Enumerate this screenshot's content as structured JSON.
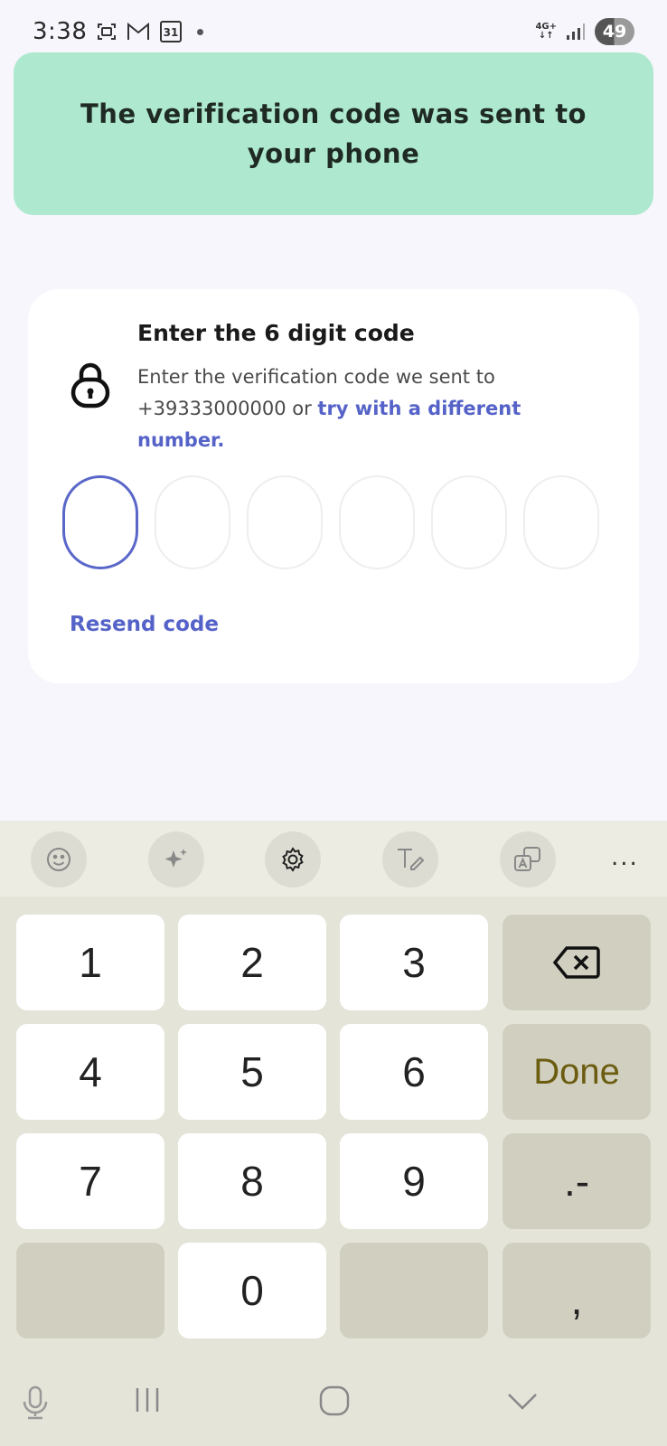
{
  "status_bar": {
    "time": "3:38",
    "network": "4G+",
    "battery": "49",
    "icons": [
      "screenshot-icon",
      "gmail-icon",
      "calendar-icon"
    ],
    "calendar_day": "31"
  },
  "toast": {
    "message": "The verification code was sent to your phone",
    "color": "#aee9cf"
  },
  "verification": {
    "title": "Enter the 6 digit code",
    "description_prefix": "Enter the verification code we sent to +39333000000 or ",
    "link_text": "try with a different number.",
    "code_length": 6,
    "digits": [
      "",
      "",
      "",
      "",
      "",
      ""
    ],
    "resend_label": "Resend code",
    "accent": "#5563c8"
  },
  "keyboard": {
    "toolbar": [
      "emoji-icon",
      "sparkle-icon",
      "settings-icon",
      "handwriting-icon",
      "translate-icon",
      "more-icon"
    ],
    "more_label": "...",
    "keys": {
      "k1": "1",
      "k2": "2",
      "k3": "3",
      "k4": "4",
      "k5": "5",
      "k6": "6",
      "k7": "7",
      "k8": "8",
      "k9": "9",
      "k0": "0",
      "done": "Done",
      "punct": ".-",
      "comma": ","
    }
  },
  "nav_bar": [
    "microphone-icon",
    "recent-apps-icon",
    "home-icon",
    "hide-keyboard-icon"
  ]
}
